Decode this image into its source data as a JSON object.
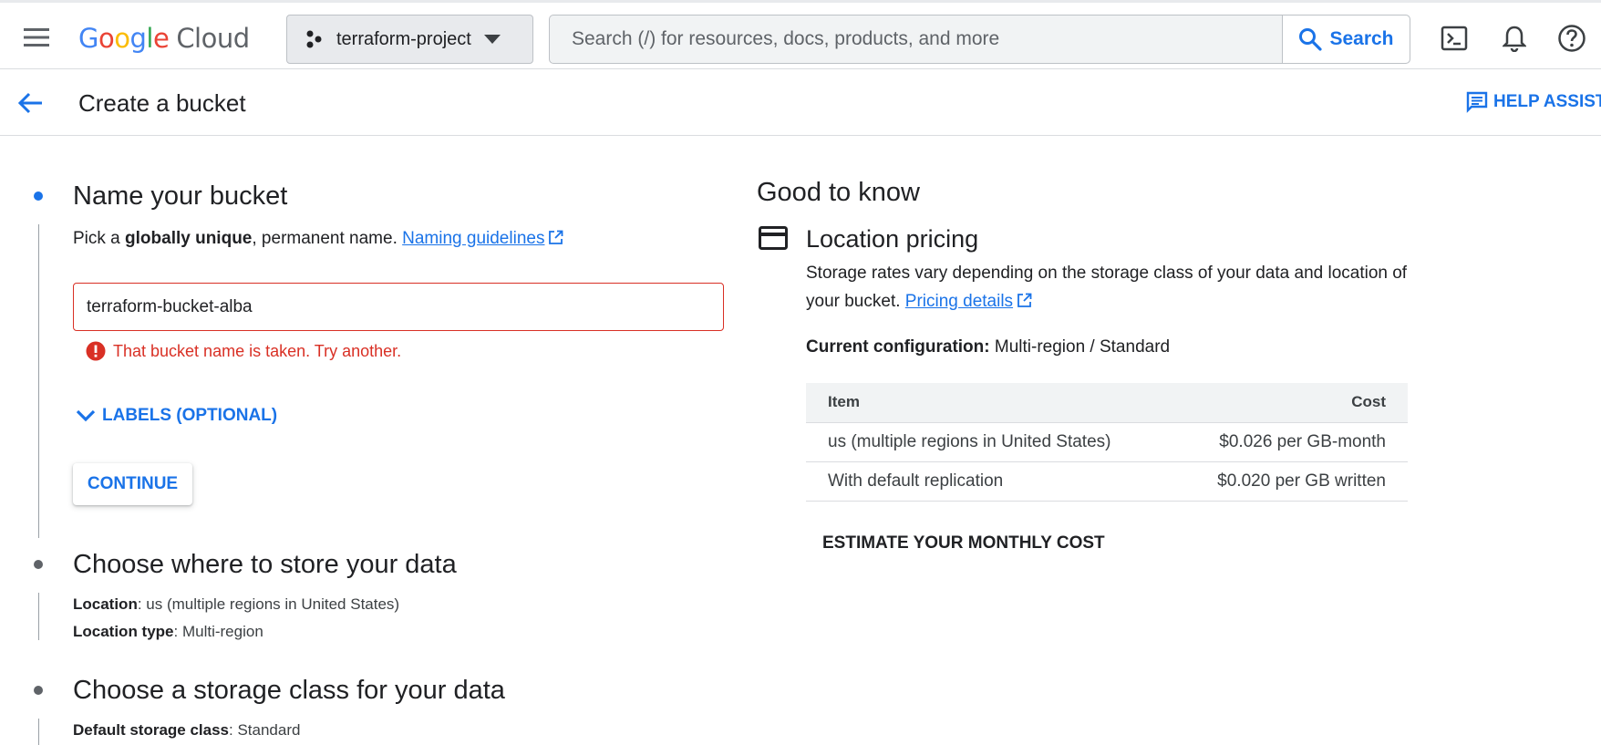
{
  "header": {
    "logo_google": "Google",
    "logo_cloud": "Cloud",
    "project_name": "terraform-project",
    "search_placeholder": "Search (/) for resources, docs, products, and more",
    "search_button": "Search"
  },
  "subheader": {
    "title": "Create a bucket",
    "help_button": "HELP ASSIST"
  },
  "step1": {
    "title": "Name your bucket",
    "desc_prefix": "Pick a ",
    "desc_bold": "globally unique",
    "desc_suffix": ", permanent name. ",
    "link": "Naming guidelines",
    "input_value": "terraform-bucket-alba",
    "error": "That bucket name is taken. Try another.",
    "labels_toggle": "LABELS (OPTIONAL)",
    "continue": "CONTINUE"
  },
  "step2": {
    "title": "Choose where to store your data",
    "location_key": "Location",
    "location_value": ": us (multiple regions in United States)",
    "type_key": "Location type",
    "type_value": ": Multi-region"
  },
  "step3": {
    "title": "Choose a storage class for your data",
    "class_key": "Default storage class",
    "class_value": ": Standard"
  },
  "good_to_know": {
    "title": "Good to know",
    "section_title": "Location pricing",
    "desc": "Storage rates vary depending on the storage class of your data and location of your bucket. ",
    "link": "Pricing details",
    "config_key": "Current configuration:",
    "config_value": " Multi-region / Standard",
    "table": {
      "headers": [
        "Item",
        "Cost"
      ],
      "rows": [
        [
          "us (multiple regions in United States)",
          "$0.026 per GB-month"
        ],
        [
          "With default replication",
          "$0.020 per GB written"
        ]
      ]
    },
    "estimate_button": "ESTIMATE YOUR MONTHLY COST"
  },
  "colors": {
    "accent": "#1a73e8",
    "error": "#d93025",
    "google_blue": "#4285f4",
    "google_red": "#ea4335",
    "google_yellow": "#fbbc05",
    "google_green": "#34a853"
  },
  "icons": [
    "menu-icon",
    "project-icon",
    "caret-down-icon",
    "search-icon",
    "cloud-shell-icon",
    "bell-icon",
    "help-icon",
    "back-arrow-icon",
    "feedback-icon",
    "external-link-icon",
    "error-icon",
    "chevron-down-icon",
    "credit-card-icon"
  ]
}
